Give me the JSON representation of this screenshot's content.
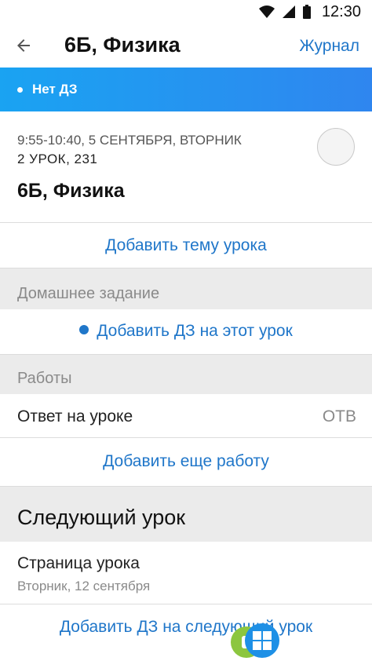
{
  "status_bar": {
    "time": "12:30"
  },
  "app_bar": {
    "title": "6Б, Физика",
    "journal_label": "Журнал"
  },
  "banner": {
    "text": "Нет ДЗ"
  },
  "lesson": {
    "time": "9:55-10:40, 5 СЕНТЯБРЯ, ВТОРНИК",
    "number_room": "2 УРОК, 231",
    "name": "6Б, Физика"
  },
  "add_topic_label": "Добавить тему урока",
  "homework": {
    "header": "Домашнее задание",
    "add_label": "Добавить ДЗ на этот урок"
  },
  "works": {
    "header": "Работы",
    "items": [
      {
        "label": "Ответ на уроке",
        "abbr": "ОТВ"
      }
    ],
    "add_label": "Добавить еще работу"
  },
  "next_lesson": {
    "header": "Следующий урок",
    "page_title": "Страница урока",
    "page_date": "Вторник, 12 сентября",
    "add_hw_label": "Добавить ДЗ на следующий урок"
  },
  "colors": {
    "accent": "#1f76c9",
    "banner_start": "#1aa3f2",
    "banner_end": "#2f86ef",
    "background": "#ebebeb"
  }
}
